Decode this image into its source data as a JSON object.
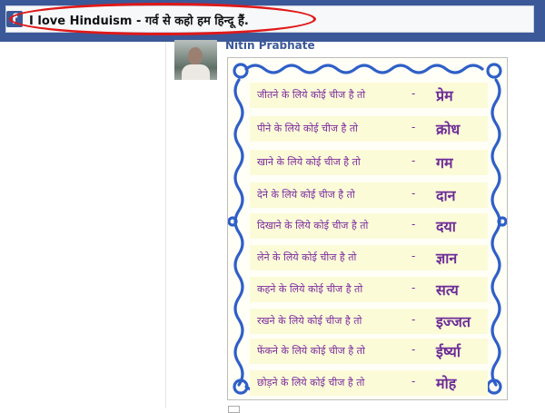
{
  "header": {
    "logo": "f",
    "page_title": "I love Hinduism - गर्व से कहो हम हिन्दू हैं."
  },
  "post": {
    "author": "Nitin Prabhate",
    "rows": [
      {
        "phrase": "जीतने के लिये कोई चीज है तो",
        "dash": "-",
        "answer": "प्रेम"
      },
      {
        "phrase": "पीने के लिये कोई चीज है तो",
        "dash": "-",
        "answer": "क्रोध"
      },
      {
        "phrase": "खाने के लिये कोई चीज है तो",
        "dash": "-",
        "answer": "गम"
      },
      {
        "phrase": "देने के लिये कोई चीज है तो",
        "dash": "-",
        "answer": "दान"
      },
      {
        "phrase": "दिखाने के लिये कोई चीज है तो",
        "dash": "-",
        "answer": "दया"
      },
      {
        "phrase": "लेने के लिये कोई चीज है तो",
        "dash": "-",
        "answer": "ज्ञान"
      },
      {
        "phrase": "कहने के लिये कोई चीज है तो",
        "dash": "-",
        "answer": "सत्य"
      },
      {
        "phrase": "रखने के लिये कोई चीज है तो",
        "dash": "-",
        "answer": "इज्जत"
      },
      {
        "phrase": "फेंकने के लिये कोई चीज है तो",
        "dash": "-",
        "answer": "ईर्ष्या"
      },
      {
        "phrase": "छोड़ने के लिये कोई चीज है तो",
        "dash": "-",
        "answer": "मोह"
      }
    ]
  },
  "colors": {
    "facebook_blue": "#3b5998",
    "highlight_red": "#e01818",
    "frame_blue": "#2f5fc8",
    "text_purple": "#7b2b9e"
  }
}
